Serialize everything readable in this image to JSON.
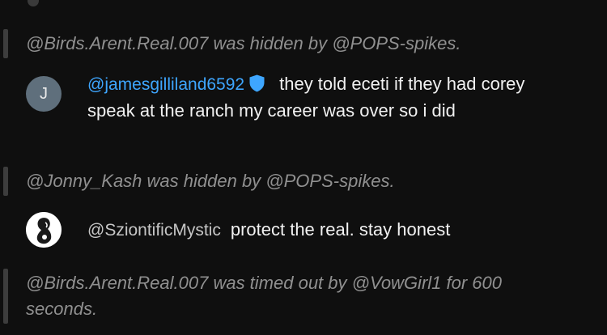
{
  "messages": [
    {
      "type": "moderation",
      "text": "@Birds.Arent.Real.007 was hidden by @POPS-spikes."
    },
    {
      "type": "chat",
      "avatar_letter": "J",
      "avatar_color": "#5f6f7c",
      "author": "@jamesgilliland6592",
      "author_color": "#3ea6ff",
      "badge_icon": "moderator-shield-icon",
      "message": "they told eceti if they had corey speak at the ranch my career was over so i did"
    },
    {
      "type": "moderation",
      "text": "@Jonny_Kash was hidden by @POPS-spikes."
    },
    {
      "type": "chat",
      "avatar_icon": "profile-silhouette-icon",
      "author": "@SziontificMystic",
      "message": "protect the real. stay honest"
    },
    {
      "type": "moderation",
      "text": "@Birds.Arent.Real.007 was timed out by @VowGirl1 for 600 seconds."
    }
  ],
  "colors": {
    "background": "#0f0f0f",
    "moderation_text": "#909090",
    "moderation_bar": "#3d3d3d",
    "message_text": "#f1f1f1",
    "moderator_blue": "#3ea6ff"
  }
}
